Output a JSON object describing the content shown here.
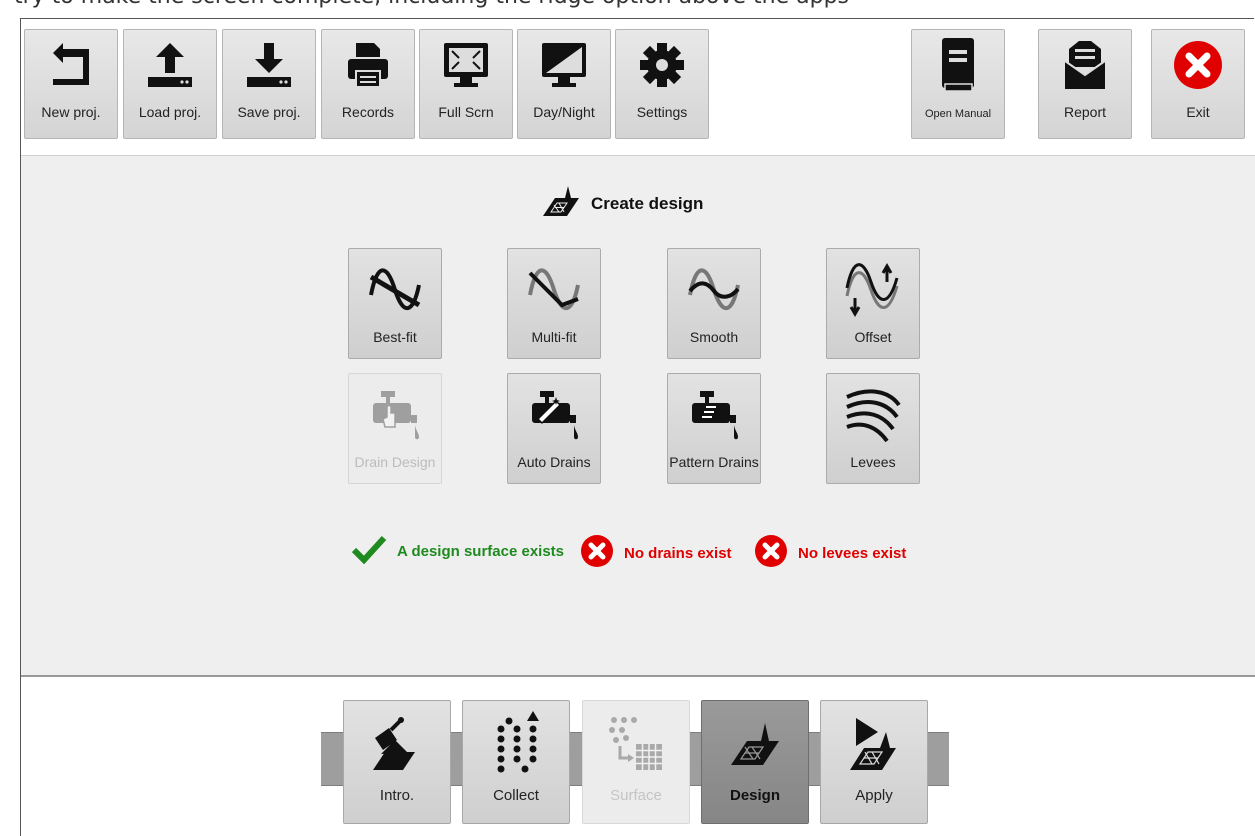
{
  "header_text": "try to make the screen complete, including the ridge option above the apps",
  "toolbar": {
    "left": [
      {
        "label": "New proj.",
        "icon": "new-project-icon"
      },
      {
        "label": "Load proj.",
        "icon": "upload-icon"
      },
      {
        "label": "Save proj.",
        "icon": "download-icon"
      },
      {
        "label": "Records",
        "icon": "printer-icon"
      },
      {
        "label": "Full Scrn",
        "icon": "fullscreen-icon"
      },
      {
        "label": "Day/Night",
        "icon": "day-night-icon"
      },
      {
        "label": "Settings",
        "icon": "gear-icon"
      }
    ],
    "right": [
      {
        "label": "Open Manual",
        "icon": "manual-book-icon"
      },
      {
        "label": "Report",
        "icon": "report-icon"
      },
      {
        "label": "Exit",
        "icon": "exit-icon"
      }
    ]
  },
  "design": {
    "title": "Create design",
    "buttons": [
      {
        "label": "Best-fit",
        "icon": "best-fit-icon",
        "enabled": true
      },
      {
        "label": "Multi-fit",
        "icon": "multi-fit-icon",
        "enabled": true
      },
      {
        "label": "Smooth",
        "icon": "smooth-icon",
        "enabled": true
      },
      {
        "label": "Offset",
        "icon": "offset-icon",
        "enabled": true
      },
      {
        "label": "Drain Design",
        "icon": "drain-design-icon",
        "enabled": false
      },
      {
        "label": "Auto Drains",
        "icon": "auto-drains-icon",
        "enabled": true
      },
      {
        "label": "Pattern Drains",
        "icon": "pattern-drains-icon",
        "enabled": true
      },
      {
        "label": "Levees",
        "icon": "levees-icon",
        "enabled": true
      }
    ],
    "status": [
      {
        "text": "A design surface exists",
        "state": "ok"
      },
      {
        "text": "No drains exist",
        "state": "error"
      },
      {
        "text": "No levees exist",
        "state": "error"
      }
    ]
  },
  "workflow": {
    "steps": [
      {
        "label": "Intro.",
        "icon": "intro-icon",
        "state": "normal"
      },
      {
        "label": "Collect",
        "icon": "collect-icon",
        "state": "normal"
      },
      {
        "label": "Surface",
        "icon": "surface-icon",
        "state": "disabled"
      },
      {
        "label": "Design",
        "icon": "design-icon",
        "state": "active"
      },
      {
        "label": "Apply",
        "icon": "apply-icon",
        "state": "normal"
      }
    ]
  },
  "colors": {
    "ok": "#1f8a1f",
    "error": "#e00000",
    "panel": "#efefef"
  }
}
